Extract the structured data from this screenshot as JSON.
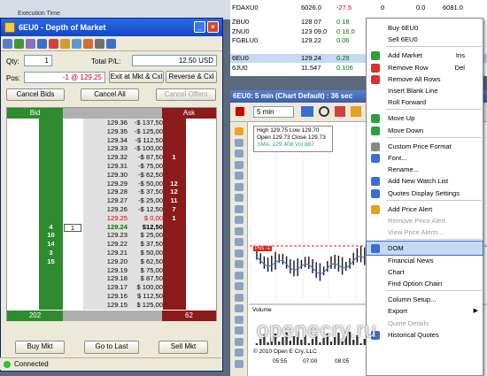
{
  "exec_label": "Execution Time",
  "dom": {
    "title": "6EU0 - Depth of Market",
    "qty_label": "Qty:",
    "qty": "1",
    "tpl_label": "Total P/L:",
    "tpl": "12.50 USD",
    "pos_label": "Pos:",
    "pos": "-1 @ 129.25",
    "exit_btn": "Exit at Mkt & Cxl",
    "reverse_btn": "Reverse & Cxl",
    "cancel_bids": "Cancel Bids",
    "cancel_all": "Cancel All",
    "cancel_offers": "Cancel Offers",
    "bid_header": "Bid",
    "ask_header": "Ask",
    "bid_total": "202",
    "ask_total": "62",
    "buy_mkt": "Buy Mkt",
    "go_last": "Go to Last",
    "sell_mkt": "Sell Mkt",
    "status": "Connected",
    "rows": [
      {
        "price": "129.36",
        "pl": "-$ 137,50",
        "bid": "",
        "ask": ""
      },
      {
        "price": "129.35",
        "pl": "-$ 125,00",
        "bid": "",
        "ask": ""
      },
      {
        "price": "129.34",
        "pl": "-$ 112,50",
        "bid": "",
        "ask": ""
      },
      {
        "price": "129.33",
        "pl": "-$ 100,00",
        "bid": "",
        "ask": ""
      },
      {
        "price": "129.32",
        "pl": "-$ 87,50",
        "bid": "",
        "ask": "1"
      },
      {
        "price": "129.31",
        "pl": "-$ 75,00",
        "bid": "",
        "ask": ""
      },
      {
        "price": "129.30",
        "pl": "-$ 62,50",
        "bid": "",
        "ask": ""
      },
      {
        "price": "129.29",
        "pl": "-$ 50,00",
        "bid": "",
        "ask": "12"
      },
      {
        "price": "129.28",
        "pl": "-$ 37,50",
        "bid": "",
        "ask": "12"
      },
      {
        "price": "129.27",
        "pl": "-$ 25,00",
        "bid": "",
        "ask": "11"
      },
      {
        "price": "129.26",
        "pl": "-$ 12,50",
        "bid": "",
        "ask": "7"
      },
      {
        "price": "129.25",
        "pl": "$ 0,00",
        "bid": "",
        "ask": "1",
        "red": true
      },
      {
        "price": "129.24",
        "pl": "$12,50",
        "bid": "4",
        "ask": "",
        "pos": "1",
        "bold": true
      },
      {
        "price": "129.23",
        "pl": "$ 25,00",
        "bid": "10",
        "ask": ""
      },
      {
        "price": "129.22",
        "pl": "$ 37,50",
        "bid": "14",
        "ask": ""
      },
      {
        "price": "129.21",
        "pl": "$ 50,00",
        "bid": "3",
        "ask": ""
      },
      {
        "price": "129.20",
        "pl": "$ 62,50",
        "bid": "15",
        "ask": ""
      },
      {
        "price": "129.19",
        "pl": "$ 75,00",
        "bid": "",
        "ask": ""
      },
      {
        "price": "129.18",
        "pl": "$ 87,50",
        "bid": "",
        "ask": ""
      },
      {
        "price": "129.17",
        "pl": "$ 100,00",
        "bid": "",
        "ask": ""
      },
      {
        "price": "129.16",
        "pl": "$ 112,50",
        "bid": "",
        "ask": ""
      },
      {
        "price": "129.15",
        "pl": "$ 125,00",
        "bid": "",
        "ask": ""
      }
    ]
  },
  "quotes": [
    {
      "sym": "FDAXU0",
      "a": "6026.0",
      "b": "-27.5",
      "c": "0",
      "d": "0.0",
      "e": "6081.0"
    },
    {
      "sym": "ZBU0",
      "a": "128 07",
      "b": "0 18",
      "c": "",
      "d": "",
      "e": ""
    },
    {
      "sym": "ZNU0",
      "a": "123 09,0",
      "b": "0 16,0",
      "c": "",
      "d": "",
      "e": ""
    },
    {
      "sym": "FGBLU0",
      "a": "129.22",
      "b": "0.06",
      "c": "",
      "d": "",
      "e": ""
    },
    {
      "sym": "6EU0",
      "a": "129.24",
      "b": "0.29",
      "c": "",
      "d": "",
      "e": ""
    },
    {
      "sym": "6JU0",
      "a": "11.547",
      "b": "0.106",
      "c": "",
      "d": "",
      "e": ""
    }
  ],
  "chart": {
    "title": "6EU0: 5 min (Chart Default) : 36 sec",
    "interval": "5 min",
    "high_lbl": "High",
    "high": "129.75",
    "low_lbl": "Low",
    "low": "129.70",
    "open_lbl": "Open",
    "open": "129.73",
    "close_lbl": "Close",
    "close": "129.73",
    "sma": "SMA: 129.408",
    "vol_lbl": "Vol",
    "vol": "887",
    "pos_tag": "Pos -1",
    "volume_lbl": "Volume",
    "copyright": "© 2010 Open E Cry, LLC",
    "times": [
      "05:55",
      "07:00",
      "08:05"
    ]
  },
  "menu": [
    {
      "label": "Buy 6EU0",
      "key": "",
      "icon": ""
    },
    {
      "label": "Sell 6EU0",
      "key": "",
      "icon": ""
    },
    {
      "sep": true
    },
    {
      "label": "Add Market",
      "key": "Ins",
      "icon": "#2e9e3e"
    },
    {
      "label": "Remove Row",
      "key": "Del",
      "icon": "#d63232"
    },
    {
      "label": "Remove All Rows",
      "key": "",
      "icon": "#d63232"
    },
    {
      "label": "Insert Blank Line",
      "key": "",
      "icon": ""
    },
    {
      "label": "Roll Forward",
      "key": "",
      "icon": ""
    },
    {
      "sep": true
    },
    {
      "label": "Move Up",
      "key": "",
      "icon": "#2e9e3e"
    },
    {
      "label": "Move Down",
      "key": "",
      "icon": "#2e9e3e"
    },
    {
      "sep": true
    },
    {
      "label": "Custom Price Format",
      "key": "",
      "icon": "#888"
    },
    {
      "label": "Font...",
      "key": "",
      "icon": "#3a6fd0"
    },
    {
      "label": "Rename...",
      "key": "",
      "icon": ""
    },
    {
      "label": "Add New Watch List",
      "key": "",
      "icon": "#3a6fd0"
    },
    {
      "label": "Quotes Display Settings",
      "key": "",
      "icon": "#3a6fd0"
    },
    {
      "sep": true
    },
    {
      "label": "Add Price Alert",
      "key": "",
      "icon": "#e0a020"
    },
    {
      "label": "Remove Price Alert",
      "key": "",
      "icon": "",
      "dis": true
    },
    {
      "label": "View Price Alerts...",
      "key": "",
      "icon": "",
      "dis": true
    },
    {
      "sep": true
    },
    {
      "label": "DOM",
      "key": "",
      "icon": "#3a6fd0",
      "sel": true
    },
    {
      "label": "Financial News",
      "key": "",
      "icon": ""
    },
    {
      "label": "Chart",
      "key": "",
      "icon": ""
    },
    {
      "label": "Find Option Chain",
      "key": "",
      "icon": ""
    },
    {
      "sep": true
    },
    {
      "label": "Column Setup...",
      "key": "",
      "icon": ""
    },
    {
      "label": "Export",
      "key": "",
      "icon": "",
      "sub": true
    },
    {
      "label": "Quote Details",
      "key": "",
      "icon": "",
      "dis": true
    },
    {
      "label": "Historical Quotes",
      "key": "",
      "icon": "#3a6fd0"
    }
  ],
  "watermark": "openecry.ru"
}
